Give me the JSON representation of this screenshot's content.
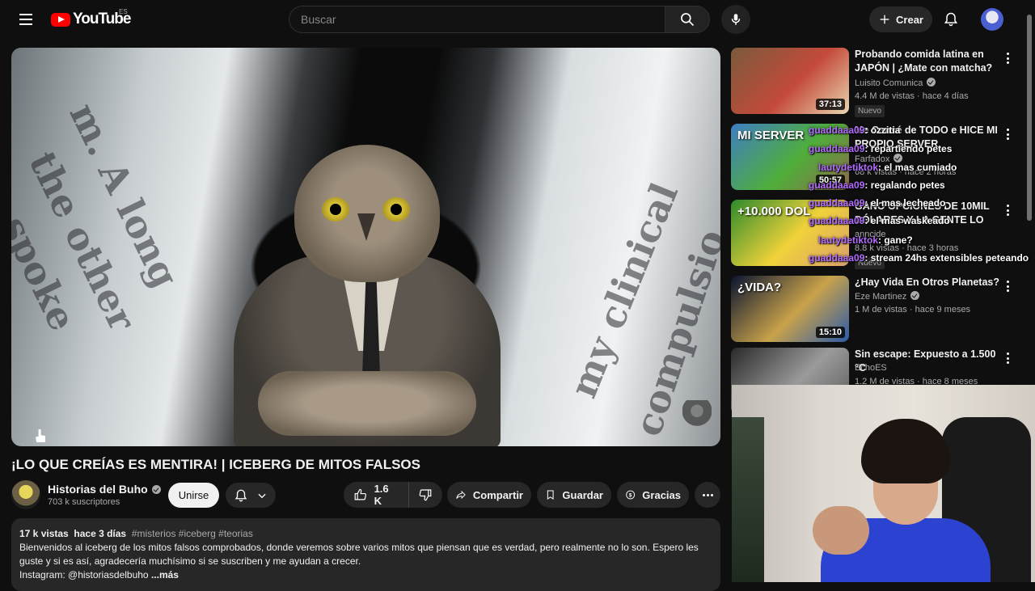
{
  "header": {
    "logo_text": "YouTube",
    "country": "ES",
    "search_placeholder": "Buscar",
    "create_label": "Crear"
  },
  "video": {
    "title": "¡LO QUE CREÍAS ES MENTIRA! | ICEBERG DE MITOS FALSOS",
    "channel": "Historias del Buho",
    "subscribers": "703 k suscriptores",
    "join_label": "Unirse",
    "likes": "1.6 K",
    "share_label": "Compartir",
    "save_label": "Guardar",
    "thanks_label": "Gracias",
    "thumbnail_text": [
      "the other",
      "spoke",
      "m. A long",
      "my clinical",
      "compulsio"
    ]
  },
  "description": {
    "views": "17 k vistas",
    "age": "hace 3 días",
    "tags": "#misterios #iceberg #teorias",
    "text": "Bienvenidos al iceberg de los mitos falsos comprobados, donde veremos sobre varios mitos que piensan que es verdad, pero realmente no lo son. Espero les guste y si es así, agradecería muchísimo si se suscriben y me ayudan a crecer.",
    "instagram": "Instagram: @historiasdelbuho",
    "more": "...más"
  },
  "sidebar": [
    {
      "title": "Probando comida latina en JAPÓN | ¿Mate con matcha? ...",
      "channel": "Luisito Comunica",
      "verified": true,
      "meta": "4.4 M de vistas · hace 4 días",
      "duration": "37:13",
      "badge": "Nuevo",
      "thumb_colors": [
        "#7a5a3c",
        "#c44a3a",
        "#e8d6b0"
      ]
    },
    {
      "title": "Me Cansé de TODO e HICE MI PROPIO SERVER",
      "channel": "Farfadox",
      "verified": true,
      "meta": "68 k vistas · hace 2 horas",
      "duration": "50:57",
      "badge": "",
      "thumb_label": "MI SERVER",
      "thumb_colors": [
        "#3f7ec2",
        "#4fae3a",
        "#8c6a4b"
      ]
    },
    {
      "title": "GANO OPCIONES DE 10MIL DÓLARES Y LA GENTE LO LLOR...",
      "channel": "anncide",
      "verified": false,
      "meta": "8.8 k vistas · hace 3 horas",
      "duration": "",
      "badge": "Nuevo",
      "thumb_label": "+10.000 DOL",
      "thumb_colors": [
        "#2c8a2c",
        "#f0d23a",
        "#d9a06c"
      ]
    },
    {
      "title": "¿Hay Vida En Otros Planetas?",
      "channel": "Eze Martinez",
      "verified": true,
      "meta": "1 M de vistas · hace 9 meses",
      "duration": "15:10",
      "badge": "",
      "thumb_label": "¿VIDA?",
      "thumb_colors": [
        "#0a1430",
        "#c8a24a",
        "#2d5aa8"
      ]
    },
    {
      "title": "Sin escape: Expuesto a 1.500 °C",
      "channel": "EchoES",
      "verified": false,
      "meta": "1.2 M de vistas · hace 8 meses",
      "duration": "",
      "badge": "",
      "thumb_colors": [
        "#2a2a2a",
        "#9a9a9a",
        "#5a5a5a"
      ]
    }
  ],
  "chat": [
    {
      "user": "guaddaaa09",
      "msg": ": ozzitia"
    },
    {
      "user": "guaddaaa09",
      "msg": ": repartiendo petes"
    },
    {
      "user": "lautydetiktok",
      "msg": ": el mas cumiado"
    },
    {
      "user": "guaddaaa09",
      "msg": ": regalando petes"
    },
    {
      "user": "guaddaaa09",
      "msg": ": el mas lecheado"
    },
    {
      "user": "guaddaaa09",
      "msg": ": el mas waskeado"
    },
    {
      "user": "lautydetiktok",
      "msg": ": gane?"
    },
    {
      "user": "guaddaaa09",
      "msg": ": stream 24hs extensibles peteando"
    }
  ],
  "colors": {
    "background": "#0f0f0f",
    "brand": "#ff0000",
    "chat_user": "#b26bff",
    "surface": "#272727"
  }
}
